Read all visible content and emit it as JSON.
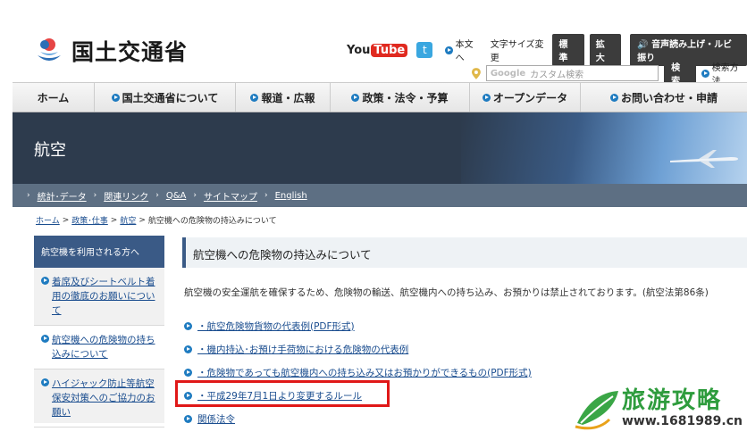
{
  "header": {
    "logo_text": "国土交通省",
    "youtube_you": "You",
    "youtube_tube": "Tube",
    "twitter_glyph": "t",
    "lang_link": "本文へ",
    "font_size_label": "文字サイズ変更",
    "font_standard": "標 準",
    "font_large": "拡 大",
    "speech_button": "音声読み上げ・ルビ振り",
    "search_google": "Google",
    "search_placeholder": "カスタム検索",
    "search_button": "検索",
    "search_method": "検索方法"
  },
  "nav": {
    "items": [
      {
        "label": "ホーム"
      },
      {
        "label": "国土交通省について"
      },
      {
        "label": "報道・広報"
      },
      {
        "label": "政策・法令・予算"
      },
      {
        "label": "オープンデータ"
      },
      {
        "label": "お問い合わせ・申請"
      }
    ]
  },
  "banner": {
    "title": "航空"
  },
  "subnav": {
    "items": [
      "統計･データ",
      "関連リンク",
      "Q&A",
      "サイトマップ",
      "English"
    ]
  },
  "breadcrumb": {
    "items": [
      "ホーム",
      "政策･仕事",
      "航空"
    ],
    "current": "航空機への危険物の持込みについて"
  },
  "sidebar": {
    "heading": "航空機を利用される方へ",
    "items": [
      "着席及びシートベルト着用の徹底のお願いについて",
      "航空機への危険物の持ち込みについて",
      "ハイジャック防止等航空保安対策へのご協力のお願い"
    ]
  },
  "main": {
    "title": "航空機への危険物の持込みについて",
    "intro": "航空機の安全運航を確保するため、危険物の輸送、航空機内への持ち込み、お預かりは禁止されております。(航空法第86条)",
    "links": [
      "・航空危険物貨物の代表例(PDF形式)",
      "・機内持込･お預け手荷物における危険物の代表例",
      "・危険物であっても航空機内への持ち込み又はお預かりができるもの(PDF形式)",
      "・平成29年7月1日より変更するルール",
      "関係法令"
    ]
  },
  "watermark": {
    "title": "旅游攻略",
    "url": "www.1681989.cn"
  },
  "colors": {
    "accent": "#1e7bc0",
    "sidebar_head": "#3a5a86",
    "highlight": "#e01818",
    "link": "#1a4d8f"
  }
}
